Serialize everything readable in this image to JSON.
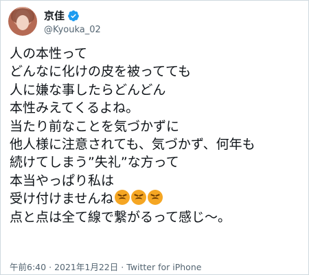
{
  "user": {
    "display_name": "京佳",
    "handle": "@Kyouka_02",
    "verified_icon": "verified-badge-icon",
    "verified_color": "#1d9bf0"
  },
  "tweet": {
    "lines": [
      "人の本性って",
      "どんなに化けの皮を被ってても",
      "人に嫌な事したらどんどん",
      "本性みえてくるよね。",
      "当たり前なことを気づかずに",
      "他人様に注意されても、気づかず、何年も",
      "続けてしまう”失礼”な方って",
      "本当やっぱり私は",
      "受け付けませんね",
      "点と点は全て線で繋がるって感じ〜。"
    ],
    "emoji_name": "persevering-face-icon",
    "emoji_count": 3
  },
  "footer": {
    "time": "午前6:40",
    "date": "2021年1月22日",
    "separator": "·",
    "source": "Twitter for iPhone"
  }
}
